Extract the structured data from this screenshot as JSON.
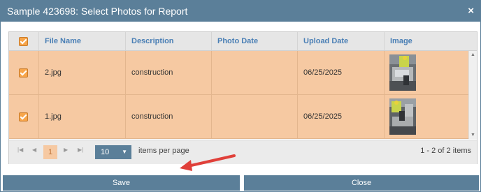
{
  "dialog": {
    "title": "Sample 423698: Select Photos for Report",
    "close_label": "×"
  },
  "grid": {
    "columns": [
      "File Name",
      "Description",
      "Photo Date",
      "Upload Date",
      "Image"
    ],
    "rows": [
      {
        "file_name": "2.jpg",
        "description": "construction",
        "photo_date": "",
        "upload_date": "06/25/2025",
        "checked": true
      },
      {
        "file_name": "1.jpg",
        "description": "construction",
        "photo_date": "",
        "upload_date": "06/25/2025",
        "checked": true
      }
    ]
  },
  "pager": {
    "current_page": "1",
    "page_size": "10",
    "items_per_page_label": "items per page",
    "info": "1 - 2 of 2 items"
  },
  "footer": {
    "save_label": "Save",
    "close_label": "Close"
  },
  "colors": {
    "header": "#5b7f99",
    "selected_row": "#f6c9a2",
    "checkbox": "#f7a54a",
    "annotation_arrow": "#e0403a"
  }
}
